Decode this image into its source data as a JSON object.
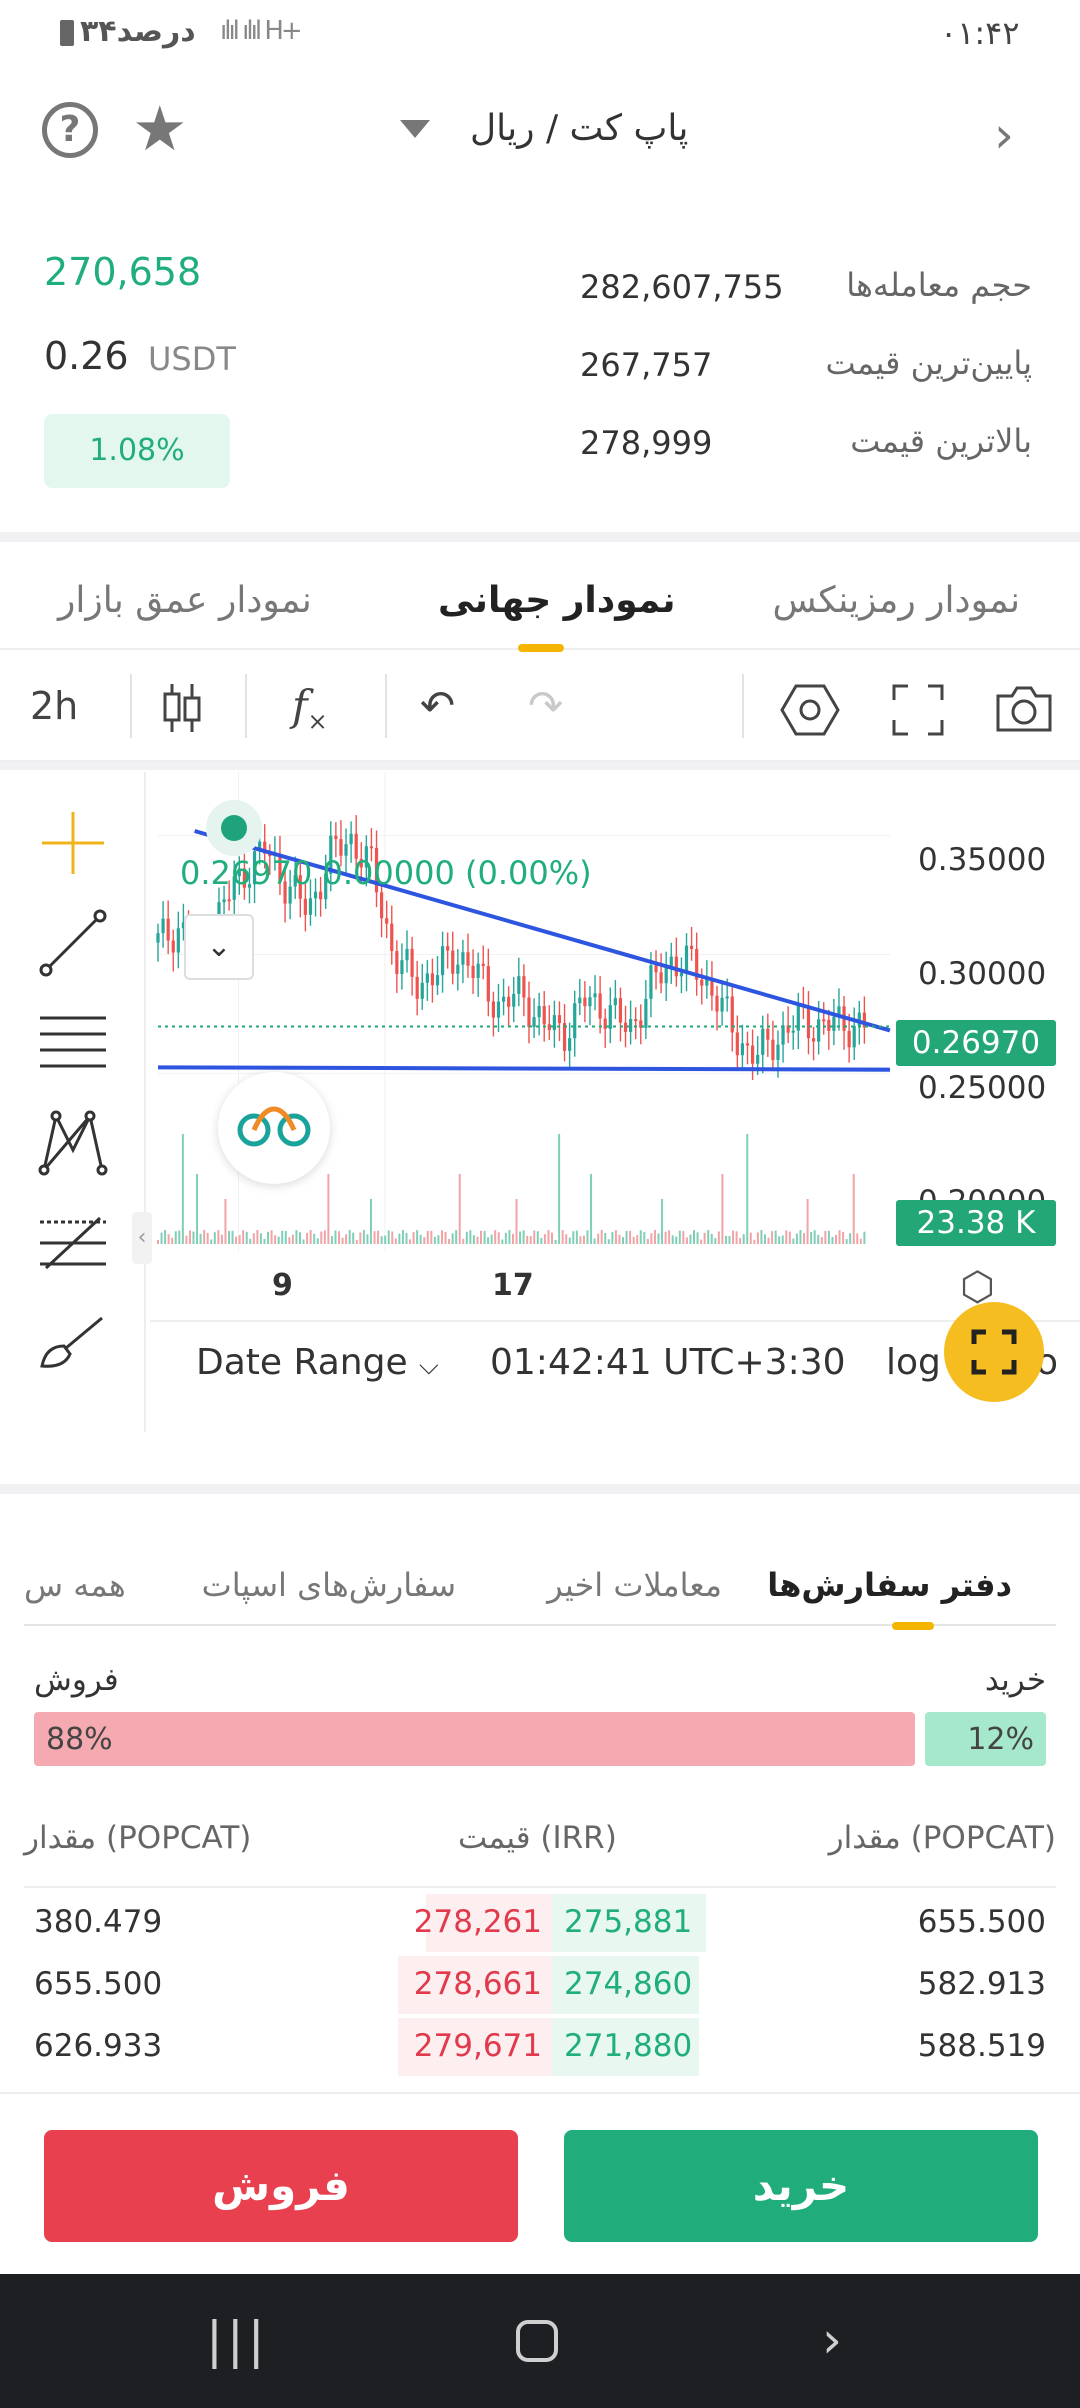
{
  "status_bar": {
    "time": "۰۱:۴۲",
    "battery": "۳۴درصد",
    "signal": "ılıl ılıl H+"
  },
  "header": {
    "title": "پاپ کت / ریال",
    "icons": [
      "help-icon",
      "star-icon",
      "dropdown-caret-icon",
      "chevron-right-icon"
    ]
  },
  "stats": {
    "last_price": "270,658",
    "usdt_price": "0.26",
    "usdt_label": "USDT",
    "change": "1.08%",
    "rows": [
      {
        "label": "حجم معامله‌ها",
        "value": "282,607,755"
      },
      {
        "label": "پایین‌ترین قیمت",
        "value": "267,757"
      },
      {
        "label": "بالاترین قیمت",
        "value": "278,999"
      }
    ]
  },
  "chart_tabs": {
    "tabs": [
      "نمودار رمزینکس",
      "نمودار جهانی",
      "نمودار عمق بازار"
    ],
    "active_index": 1
  },
  "chart_toolbar": {
    "interval": "2h",
    "icons": [
      "candles-icon",
      "indicators-icon",
      "undo-icon",
      "redo-icon",
      "settings-hex-icon",
      "fullscreen-icon",
      "camera-icon"
    ]
  },
  "chart": {
    "ohlc_line": "0.26970 0.00000 (0.00%)",
    "current_price_tag": "0.26970",
    "volume_tag": "23.38 K",
    "y_labels": [
      "0.35000",
      "0.30000",
      "0.25000",
      "0.20000"
    ],
    "x_labels": [
      "9",
      "17"
    ],
    "date_range_label": "Date Range",
    "clock": "01:42:41 UTC+3:30",
    "log_label": "log",
    "auto_label": "o",
    "drawing_tools": [
      "crosshair-icon",
      "trend-line-icon",
      "horizontal-lines-icon",
      "pattern-icon",
      "fib-icon",
      "brush-icon"
    ]
  },
  "chart_data": {
    "type": "line",
    "series": [
      {
        "values": [
          0.305,
          0.312,
          0.299,
          0.32,
          0.335,
          0.344,
          0.33,
          0.318,
          0.341,
          0.349,
          0.336,
          0.3,
          0.288,
          0.292,
          0.301,
          0.29,
          0.278,
          0.284,
          0.27,
          0.268,
          0.281,
          0.277,
          0.268,
          0.286,
          0.298,
          0.295,
          0.284,
          0.265,
          0.257,
          0.266,
          0.272,
          0.27,
          0.271,
          0.2697
        ]
      }
    ],
    "ylim": [
      0.2,
      0.36
    ],
    "ylabel": "",
    "xlabel": "",
    "x_tick_labels": [
      "9",
      "17"
    ],
    "trendlines": [
      {
        "from": [
          0.05,
          0.352
        ],
        "to": [
          1.0,
          0.268
        ]
      },
      {
        "from": [
          0.0,
          0.2525
        ],
        "to": [
          1.0,
          0.2515
        ]
      }
    ],
    "last_value": 0.2697,
    "volume_last": "23.38 K"
  },
  "orderbook_tabs": {
    "tabs": [
      "دفتر سفارش‌ها",
      "معاملات اخیر",
      "سفارش‌های اسپات",
      "همه س"
    ],
    "active_index": 0
  },
  "ratio": {
    "sell_label": "فروش",
    "buy_label": "خرید",
    "sell_percent": "88%",
    "buy_percent": "12%",
    "sell_fraction": 0.88,
    "buy_fraction": 0.12
  },
  "orderbook": {
    "headers": {
      "sell_amount": "مقدار (POPCAT)",
      "price": "قیمت (IRR)",
      "buy_amount": "مقدار (POPCAT)"
    },
    "rows": [
      {
        "sell_amount": "380.479",
        "sell_price": "278,261",
        "buy_price": "275,881",
        "buy_amount": "655.500",
        "sell_depth": 0.18,
        "buy_depth": 0.22
      },
      {
        "sell_amount": "655.500",
        "sell_price": "278,661",
        "buy_price": "274,860",
        "buy_amount": "582.913",
        "sell_depth": 0.22,
        "buy_depth": 0.21
      },
      {
        "sell_amount": "626.933",
        "sell_price": "279,671",
        "buy_price": "271,880",
        "buy_amount": "588.519",
        "sell_depth": 0.22,
        "buy_depth": 0.21
      }
    ]
  },
  "actions": {
    "sell": "فروش",
    "buy": "خرید"
  },
  "nav_bar": {
    "icons": [
      "recents-icon",
      "home-icon",
      "back-icon"
    ]
  },
  "colors": {
    "green": "#1fae7c",
    "red": "#e8404f",
    "accent": "#f4b400",
    "trendline": "#2d55e0"
  }
}
